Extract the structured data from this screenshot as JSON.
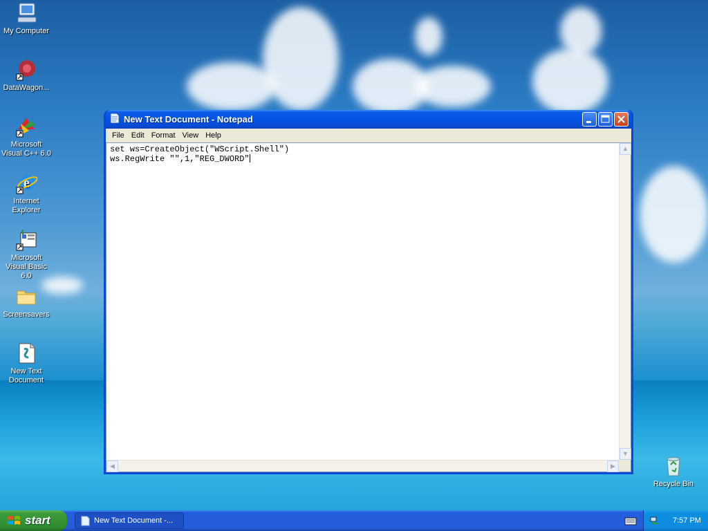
{
  "desktop": {
    "icons": [
      {
        "label": "My Computer",
        "icon": "my-computer-icon"
      },
      {
        "label": "DataWagon...",
        "icon": "datawagon-icon"
      },
      {
        "label": "Microsoft Visual C++ 6.0",
        "icon": "visual-cpp-icon"
      },
      {
        "label": "Internet Explorer",
        "icon": "internet-explorer-icon"
      },
      {
        "label": "Microsoft Visual Basic 6.0",
        "icon": "visual-basic-icon"
      },
      {
        "label": "Screensavers",
        "icon": "folder-icon"
      },
      {
        "label": "New Text Document",
        "icon": "text-document-icon"
      },
      {
        "label": "Recycle Bin",
        "icon": "recycle-bin-icon"
      }
    ]
  },
  "window": {
    "title": "New Text Document - Notepad",
    "menu": [
      "File",
      "Edit",
      "Format",
      "View",
      "Help"
    ],
    "content_lines": [
      "set ws=CreateObject(\"WScript.Shell\")",
      "ws.RegWrite \"\",1,\"REG_DWORD\""
    ]
  },
  "taskbar": {
    "start_label": "start",
    "task_label": "New Text Document -...",
    "clock": "7:57 PM"
  },
  "colors": {
    "titlebar": "#0553e3",
    "menubar": "#ece9d8",
    "start_green": "#3c9b3c",
    "taskbar_blue": "#245edb"
  }
}
